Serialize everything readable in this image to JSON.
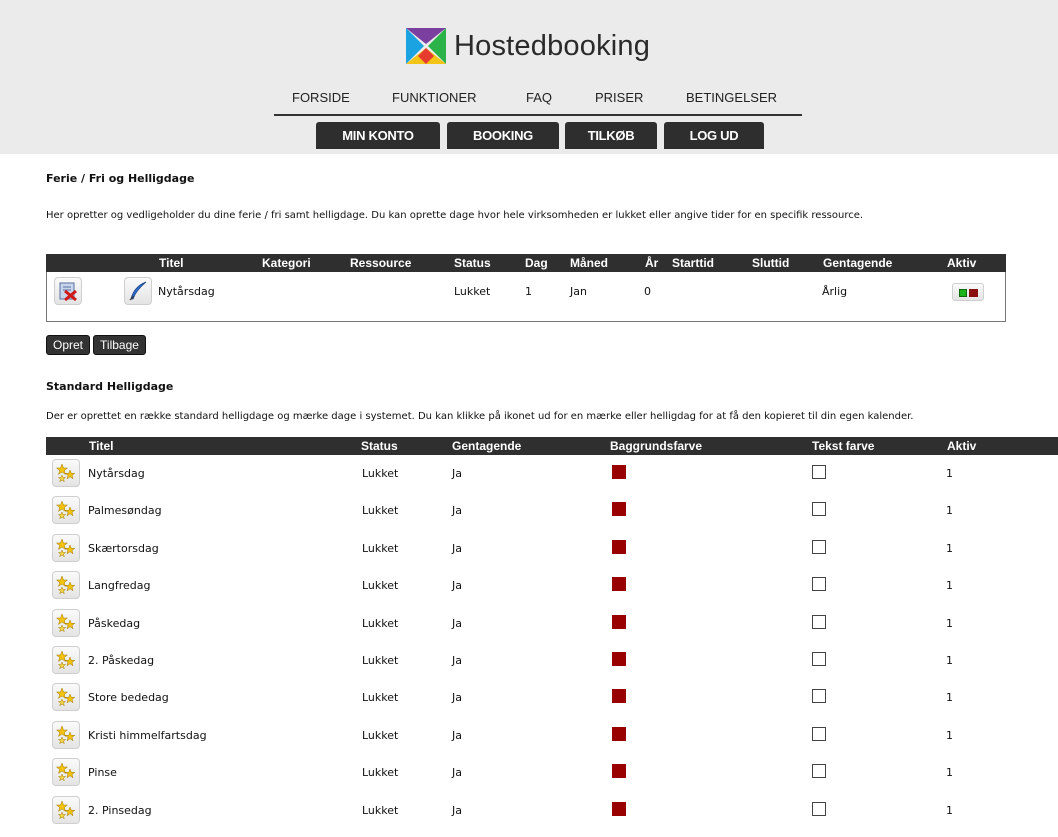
{
  "brand": {
    "name": "Hostedbooking"
  },
  "topnav": [
    "FORSIDE",
    "FUNKTIONER",
    "FAQ",
    "PRISER",
    "BETINGELSER"
  ],
  "subnav": [
    "MIN KONTO",
    "BOOKING",
    "TILKØB",
    "LOG UD"
  ],
  "section1": {
    "title": "Ferie / Fri og Helligdage",
    "description": "Her opretter og vedligeholder du dine ferie / fri samt helligdage. Du kan oprette dage hvor hele virksomheden er lukket eller angive tider for en specifik ressource.",
    "columns": [
      "Titel",
      "Kategori",
      "Ressource",
      "Status",
      "Dag",
      "Måned",
      "År",
      "Starttid",
      "Sluttid",
      "Gentagende",
      "Aktiv"
    ],
    "row": {
      "titel": "Nytårsdag",
      "kategori": "",
      "ressource": "",
      "status": "Lukket",
      "dag": "1",
      "maaned": "Jan",
      "aar": "0",
      "starttid": "",
      "sluttid": "",
      "gentagende": "Årlig",
      "aktiv": true
    },
    "buttons": {
      "create": "Opret",
      "back": "Tilbage"
    }
  },
  "section2": {
    "title": "Standard Helligdage",
    "description": "Der er oprettet en række standard helligdage og mærke dage i systemet. Du kan klikke på ikonet ud for en mærke eller helligdag for at få den kopieret til din egen kalender.",
    "columns": [
      "Titel",
      "Status",
      "Gentagende",
      "Baggrundsfarve",
      "Tekst farve",
      "Aktiv"
    ],
    "background_color": "#990000",
    "text_color": "#ffffff",
    "rows": [
      {
        "titel": "Nytårsdag",
        "status": "Lukket",
        "gentagende": "Ja",
        "aktiv": "1"
      },
      {
        "titel": "Palmesøndag",
        "status": "Lukket",
        "gentagende": "Ja",
        "aktiv": "1"
      },
      {
        "titel": "Skærtorsdag",
        "status": "Lukket",
        "gentagende": "Ja",
        "aktiv": "1"
      },
      {
        "titel": "Langfredag",
        "status": "Lukket",
        "gentagende": "Ja",
        "aktiv": "1"
      },
      {
        "titel": "Påskedag",
        "status": "Lukket",
        "gentagende": "Ja",
        "aktiv": "1"
      },
      {
        "titel": "2. Påskedag",
        "status": "Lukket",
        "gentagende": "Ja",
        "aktiv": "1"
      },
      {
        "titel": "Store bededag",
        "status": "Lukket",
        "gentagende": "Ja",
        "aktiv": "1"
      },
      {
        "titel": "Kristi himmelfartsdag",
        "status": "Lukket",
        "gentagende": "Ja",
        "aktiv": "1"
      },
      {
        "titel": "Pinse",
        "status": "Lukket",
        "gentagende": "Ja",
        "aktiv": "1"
      },
      {
        "titel": "2. Pinsedag",
        "status": "Lukket",
        "gentagende": "Ja",
        "aktiv": "1"
      }
    ]
  },
  "icons": {
    "logo": "hostedbooking-logo-icon",
    "delete": "delete-icon",
    "edit": "edit-quill-icon",
    "copy": "copy-stars-icon",
    "toggle": "active-toggle-icon"
  },
  "colors": {
    "header_bg": "#ebebeb",
    "nav_dark": "#2e2e2e",
    "active_on": "#1db31d",
    "active_off": "#8a0d0d"
  }
}
